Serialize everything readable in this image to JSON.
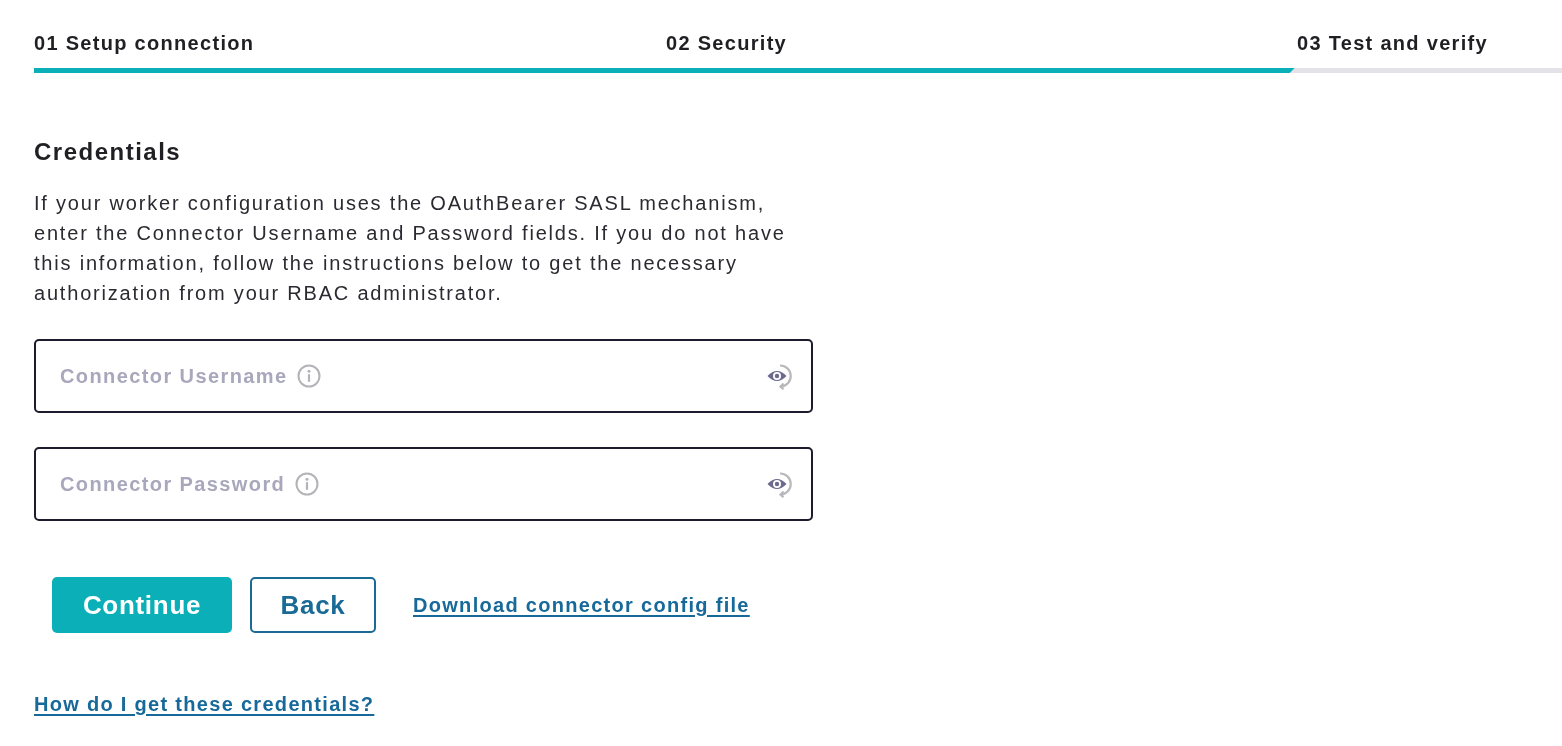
{
  "steps": [
    {
      "label": "01 Setup connection"
    },
    {
      "label": "02 Security"
    },
    {
      "label": "03 Test and verify"
    }
  ],
  "progress": {
    "level": 0.825
  },
  "section": {
    "title": "Credentials",
    "description": "If your worker configuration uses the OAuthBearer SASL mechanism, enter the Connector Username and Password fields. If you do not have this information, follow the instructions below to get the necessary authorization from your RBAC administrator."
  },
  "fields": [
    {
      "placeholder": "Connector Username"
    },
    {
      "placeholder": "Connector Password"
    }
  ],
  "actions": [
    {
      "label": "Continue",
      "kind": "primary"
    },
    {
      "label": "Back",
      "kind": "secondary"
    },
    {
      "label": "Download connector config file",
      "kind": "link"
    }
  ],
  "help_link": "How do I get these credentials?"
}
